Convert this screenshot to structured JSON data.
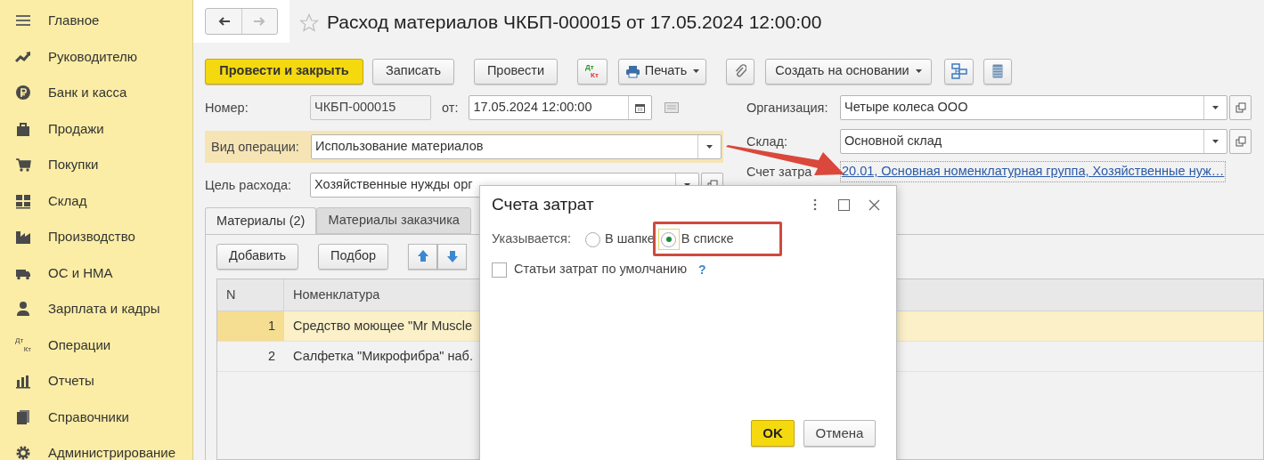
{
  "sidebar": {
    "items": [
      {
        "label": "Главное",
        "kind": "menu"
      },
      {
        "label": "Руководителю",
        "kind": "trend"
      },
      {
        "label": "Банк и касса",
        "kind": "ruble"
      },
      {
        "label": "Продажи",
        "kind": "bag"
      },
      {
        "label": "Покупки",
        "kind": "cart"
      },
      {
        "label": "Склад",
        "kind": "grid"
      },
      {
        "label": "Производство",
        "kind": "factory"
      },
      {
        "label": "ОС и НМА",
        "kind": "truck"
      },
      {
        "label": "Зарплата и кадры",
        "kind": "person"
      },
      {
        "label": "Операции",
        "kind": "dtkt",
        "icon_text": [
          "Дт",
          "Кт"
        ]
      },
      {
        "label": "Отчеты",
        "kind": "bars"
      },
      {
        "label": "Справочники",
        "kind": "books"
      },
      {
        "label": "Администрирование",
        "kind": "gear"
      }
    ]
  },
  "navigation": {
    "back": {
      "disabled": false
    },
    "forward": {
      "disabled": true
    }
  },
  "window": {
    "title": "Расход материалов ЧКБП-000015 от 17.05.2024 12:00:00"
  },
  "toolbar": [
    {
      "kind": "primary",
      "label": "Провести и закрыть"
    },
    {
      "kind": "button",
      "label": "Записать"
    },
    {
      "kind": "button",
      "label": "Провести"
    },
    {
      "kind": "dtkt",
      "top": "Дт",
      "bottom": "Кт"
    },
    {
      "kind": "print",
      "label": "Печать"
    },
    {
      "kind": "attach"
    },
    {
      "kind": "menu",
      "label": "Создать на основании"
    },
    {
      "kind": "structure"
    },
    {
      "kind": "list"
    }
  ],
  "form": {
    "number": {
      "label": "Номер:",
      "value": "ЧКБП-000015"
    },
    "date": {
      "label": "от:",
      "value": "17.05.2024 12:00:00"
    },
    "operation_type": {
      "label": "Вид операции:",
      "value": "Использование материалов",
      "highlighted": true
    },
    "purpose": {
      "label": "Цель расхода:",
      "value": "Хозяйственные нужды орг"
    },
    "organization": {
      "label": "Организация:",
      "value": "Четыре колеса ООО"
    },
    "warehouse": {
      "label": "Склад:",
      "value": "Основной склад"
    },
    "cost_account": {
      "label": "Счет затра",
      "value": "20.01, Основная номенклатурная группа, Хозяйственные нуж…"
    }
  },
  "tabs": [
    {
      "label": "Материалы (2)",
      "selected": true
    },
    {
      "label": "Материалы заказчика",
      "selected": false
    }
  ],
  "table_toolbar": {
    "buttons": [
      "Добавить",
      "Подбор"
    ]
  },
  "table": {
    "columns": [
      "N",
      "Номенклатура"
    ],
    "rows": [
      {
        "cells": [
          "1",
          "Средство моющее \"Mr Muscle"
        ],
        "selected": true
      },
      {
        "cells": [
          "2",
          "Салфетка \"Микрофибра\" наб."
        ],
        "selected": false
      }
    ]
  },
  "dialog": {
    "title": "Счета затрат",
    "radio_label": "Указывается:",
    "options": [
      {
        "label": "В шапке",
        "selected": false
      },
      {
        "label": "В списке",
        "selected": true
      }
    ],
    "checkbox": {
      "label": "Статьи затрат по умолчанию",
      "checked": false
    },
    "help": "?",
    "buttons": [
      {
        "label": "OK",
        "default": true
      },
      {
        "label": "Отмена",
        "default": false
      }
    ]
  }
}
